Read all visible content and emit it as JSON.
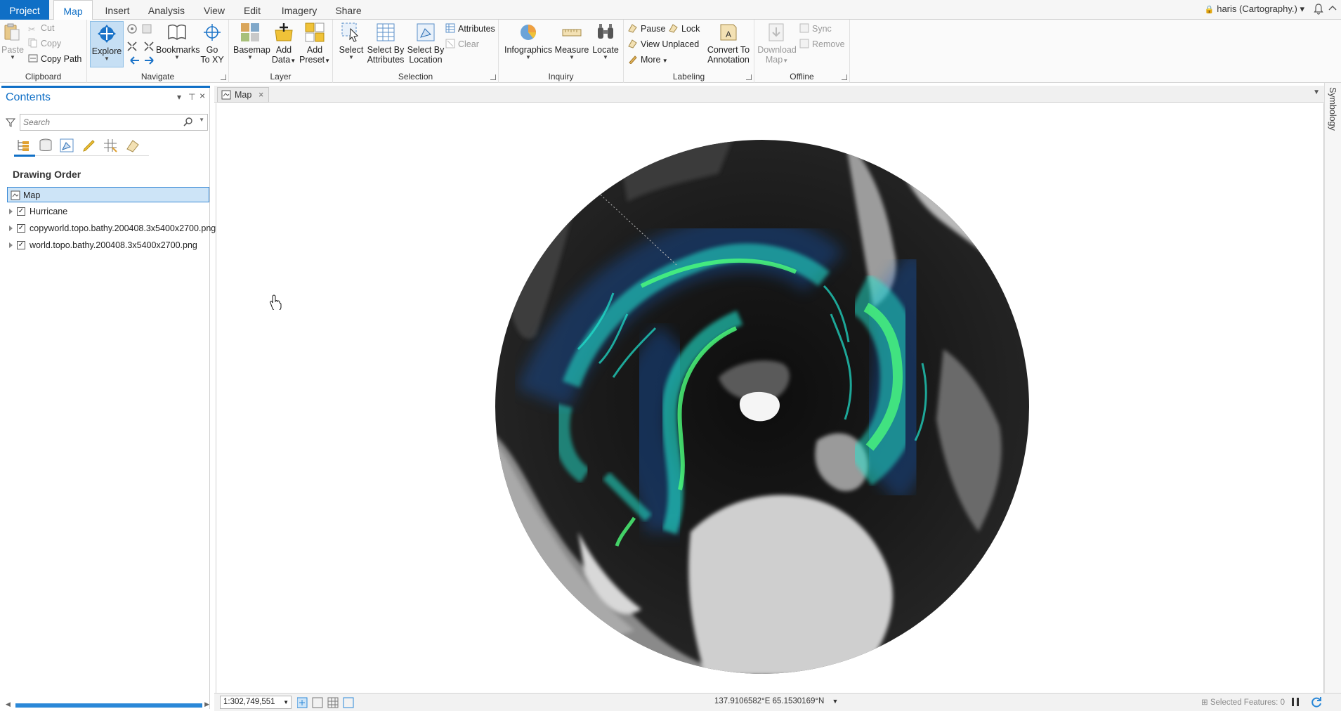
{
  "tabs": {
    "project": "Project",
    "map": "Map",
    "insert": "Insert",
    "analysis": "Analysis",
    "view": "View",
    "edit": "Edit",
    "imagery": "Imagery",
    "share": "Share"
  },
  "user": "haris (Cartography.) ▾",
  "ribbon": {
    "clipboard": {
      "label": "Clipboard",
      "paste": "Paste",
      "cut": "Cut",
      "copy": "Copy",
      "copy_path": "Copy Path"
    },
    "navigate": {
      "label": "Navigate",
      "explore": "Explore",
      "bookmarks": "Bookmarks",
      "go_to_xy_1": "Go",
      "go_to_xy_2": "To XY"
    },
    "layer": {
      "label": "Layer",
      "basemap": "Basemap",
      "add_data_1": "Add",
      "add_data_2": "Data",
      "add_preset_1": "Add",
      "add_preset_2": "Preset"
    },
    "selection": {
      "label": "Selection",
      "select": "Select",
      "select_by_attr_1": "Select By",
      "select_by_attr_2": "Attributes",
      "select_by_loc_1": "Select By",
      "select_by_loc_2": "Location",
      "attributes": "Attributes",
      "clear": "Clear"
    },
    "inquiry": {
      "label": "Inquiry",
      "infographics": "Infographics",
      "measure": "Measure",
      "locate": "Locate"
    },
    "labeling": {
      "label": "Labeling",
      "pause": "Pause",
      "lock": "Lock",
      "view_unplaced": "View Unplaced",
      "more": "More",
      "convert_1": "Convert To",
      "convert_2": "Annotation"
    },
    "offline": {
      "label": "Offline",
      "download_1": "Download",
      "download_2": "Map",
      "sync": "Sync",
      "remove": "Remove"
    }
  },
  "contents": {
    "title": "Contents",
    "search_placeholder": "Search",
    "drawing_order": "Drawing Order",
    "layers": [
      {
        "name": "Map"
      },
      {
        "name": "Hurricane"
      },
      {
        "name": "copyworld.topo.bathy.200408.3x5400x2700.png"
      },
      {
        "name": "world.topo.bathy.200408.3x5400x2700.png"
      }
    ]
  },
  "map_tab": "Map",
  "status": {
    "scale": "1:302,749,551",
    "coords": "137.9106582°E 65.1530169°N",
    "selected_features": "Selected Features: 0"
  },
  "right_strip": {
    "symbology": "Symbology"
  },
  "colors": {
    "accent": "#0f6fc6",
    "track_glow": "#21e6d0",
    "track_core": "#4dff7a",
    "track_dim": "#1260c8"
  },
  "icons": [
    "paste-icon",
    "cut-icon",
    "copy-icon",
    "copy-path-icon",
    "explore-icon",
    "bookmarks-icon",
    "go-to-xy-icon",
    "basemap-icon",
    "add-data-icon",
    "add-preset-icon",
    "select-icon",
    "select-by-attributes-icon",
    "select-by-location-icon",
    "attributes-icon",
    "clear-icon",
    "infographics-icon",
    "measure-icon",
    "locate-icon",
    "pause-icon",
    "lock-icon",
    "view-unplaced-icon",
    "more-icon",
    "convert-to-annotation-icon",
    "download-map-icon",
    "sync-icon",
    "remove-icon",
    "filter-icon",
    "search-icon",
    "pin-icon",
    "close-icon",
    "hand-cursor-icon"
  ]
}
